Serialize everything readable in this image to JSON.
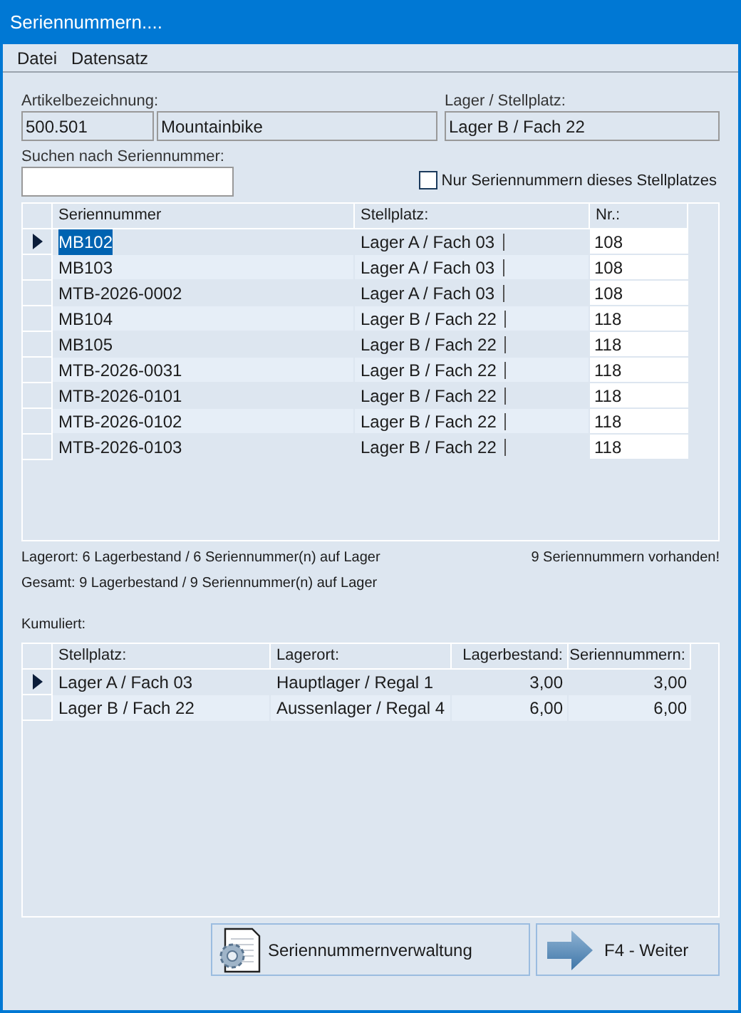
{
  "window": {
    "title": "Seriennummern...."
  },
  "menu": [
    "Datei",
    "Datensatz"
  ],
  "article": {
    "label": "Artikelbezeichnung:",
    "number": "500.501",
    "name": "Mountainbike"
  },
  "location": {
    "label": "Lager / Stellplatz:",
    "value": "Lager B / Fach 22"
  },
  "search": {
    "label": "Suchen nach Seriennummer:"
  },
  "filter": {
    "label": "Nur Seriennummern dieses Stellplatzes",
    "checked": false
  },
  "serials": {
    "columns": [
      "Seriennummer",
      "Stellplatz:",
      "Nr.:"
    ],
    "rows": [
      {
        "serial": "MB102",
        "place": "Lager A / Fach 03",
        "nr": "108",
        "selected": true
      },
      {
        "serial": "MB103",
        "place": "Lager A / Fach 03",
        "nr": "108",
        "selected": false
      },
      {
        "serial": "MTB-2026-0002",
        "place": "Lager A / Fach 03",
        "nr": "108",
        "selected": false
      },
      {
        "serial": "MB104",
        "place": "Lager B / Fach 22",
        "nr": "118",
        "selected": false
      },
      {
        "serial": "MB105",
        "place": "Lager B / Fach 22",
        "nr": "118",
        "selected": false
      },
      {
        "serial": "MTB-2026-0031",
        "place": "Lager B / Fach 22",
        "nr": "118",
        "selected": false
      },
      {
        "serial": "MTB-2026-0101",
        "place": "Lager B / Fach 22",
        "nr": "118",
        "selected": false
      },
      {
        "serial": "MTB-2026-0102",
        "place": "Lager B / Fach 22",
        "nr": "118",
        "selected": false
      },
      {
        "serial": "MTB-2026-0103",
        "place": "Lager B / Fach 22",
        "nr": "118",
        "selected": false
      }
    ]
  },
  "summary": {
    "location_line": "Lagerort: 6 Lagerbestand / 6 Seriennummer(n) auf Lager",
    "total_line": "Gesamt:  9 Lagerbestand / 9 Seriennummer(n) auf Lager",
    "count": "9 Seriennummern vorhanden!"
  },
  "cumulative": {
    "label": "Kumuliert:",
    "columns": [
      "Stellplatz:",
      "Lagerort:",
      "Lagerbestand:",
      "Seriennummern:"
    ],
    "rows": [
      {
        "place": "Lager A / Fach 03",
        "location": "Hauptlager / Regal 1",
        "stock": "3,00",
        "serials": "3,00",
        "selected": true
      },
      {
        "place": "Lager B / Fach 22",
        "location": "Aussenlager / Regal 4",
        "stock": "6,00",
        "serials": "6,00",
        "selected": false
      }
    ]
  },
  "buttons": [
    {
      "label": "Seriennummernverwaltung",
      "kind": "manage"
    },
    {
      "label": "F4 - Weiter",
      "kind": "next"
    }
  ]
}
